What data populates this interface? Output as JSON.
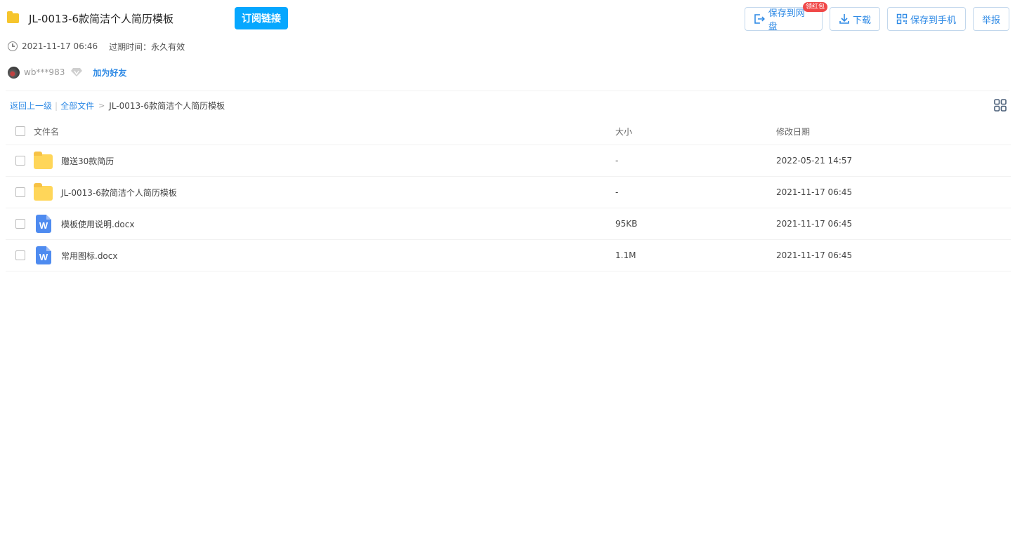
{
  "header": {
    "title": "JL-0013-6款简洁个人简历模板",
    "subscribe_label": "订阅链接",
    "actions": {
      "save_to_netdisk": "保存到网盘",
      "badge": "领红包",
      "download": "下载",
      "save_to_phone": "保存到手机",
      "report": "举报"
    },
    "share_time": "2021-11-17 06:46",
    "expire_text": "过期时间：永久有效",
    "user": {
      "name": "wb***983",
      "add_friend": "加为好友"
    }
  },
  "breadcrumb": {
    "back": "返回上一级",
    "sep": "|",
    "all_files": "全部文件",
    "arrow": ">",
    "current": "JL-0013-6款简洁个人简历模板"
  },
  "table": {
    "columns": {
      "name": "文件名",
      "size": "大小",
      "modified": "修改日期"
    },
    "rows": [
      {
        "type": "folder",
        "name": "赠送30款简历",
        "size": "-",
        "modified": "2022-05-21 14:57"
      },
      {
        "type": "folder",
        "name": "JL-0013-6款简洁个人简历模板",
        "size": "-",
        "modified": "2021-11-17 06:45"
      },
      {
        "type": "word",
        "name": "模板使用说明.docx",
        "size": "95KB",
        "modified": "2021-11-17 06:45"
      },
      {
        "type": "word",
        "name": "常用图标.docx",
        "size": "1.1M",
        "modified": "2021-11-17 06:45"
      }
    ]
  },
  "icons": {
    "word_letter": "W"
  },
  "colors": {
    "accent": "#06a7ff",
    "link": "#2f8ae5",
    "badge": "#f04848",
    "folder": "#ffd659",
    "word": "#4e8bf0"
  }
}
